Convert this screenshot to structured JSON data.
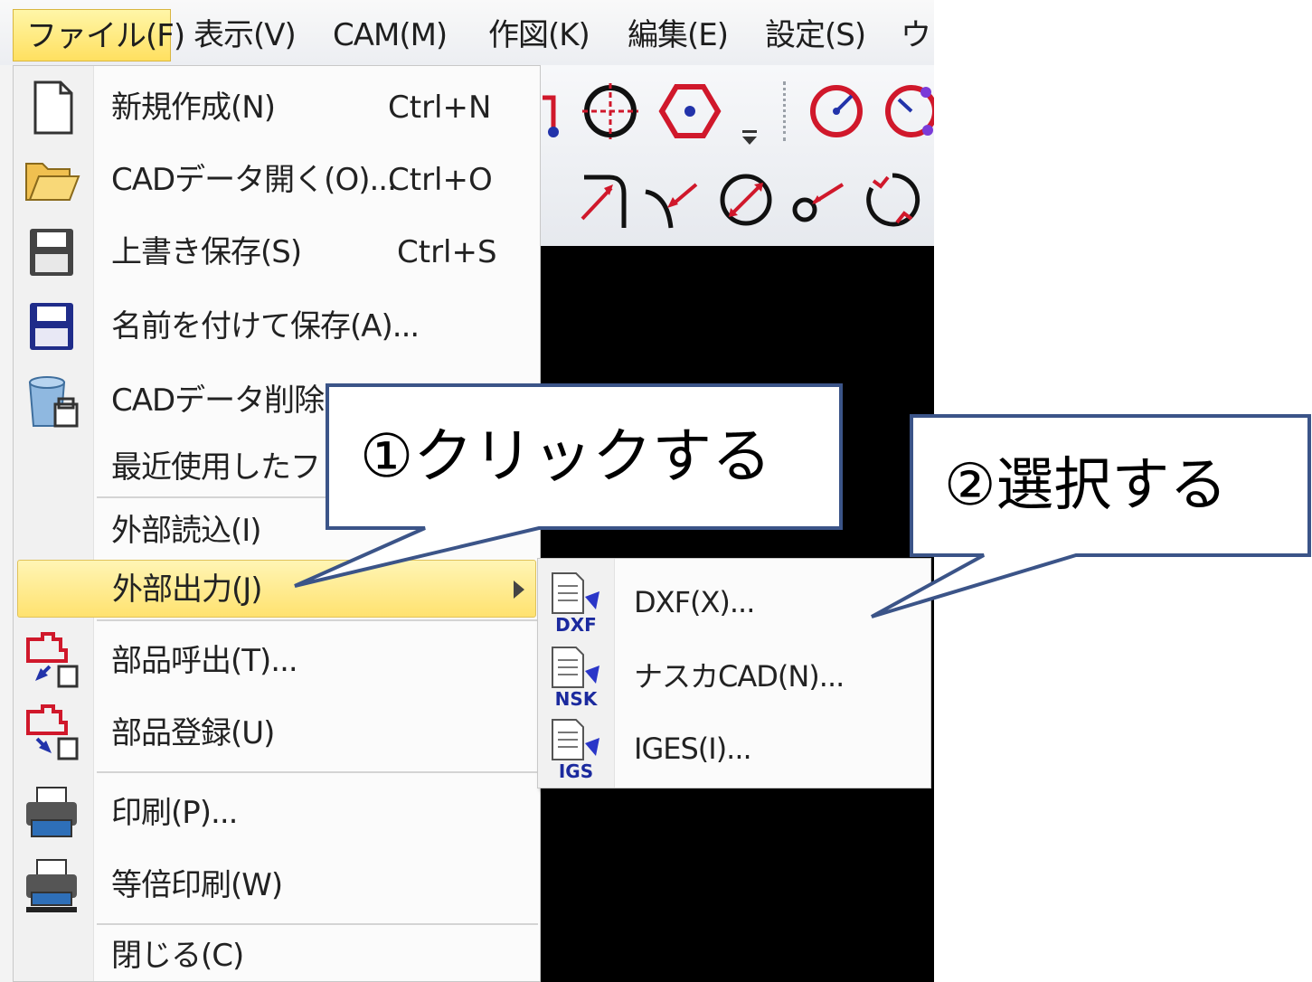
{
  "menubar": {
    "items": [
      {
        "label": "ファイル(F)",
        "active": true
      },
      {
        "label": "表示(V)"
      },
      {
        "label": "CAM(M)"
      },
      {
        "label": "作図(K)"
      },
      {
        "label": "編集(E)"
      },
      {
        "label": "設定(S)"
      },
      {
        "label": "ウィ"
      }
    ]
  },
  "file_menu": {
    "items": [
      {
        "label": "新規作成(N)",
        "shortcut": "Ctrl+N",
        "icon": "new-document-icon"
      },
      {
        "label": "CADデータ開く(O)...",
        "shortcut": "Ctrl+O",
        "icon": "open-folder-icon"
      },
      {
        "label": "上書き保存(S)",
        "shortcut": "Ctrl+S",
        "icon": "save-icon"
      },
      {
        "label": "名前を付けて保存(A)...",
        "icon": "save-as-icon"
      },
      {
        "label": "CADデータ削除(D",
        "icon": "delete-data-icon"
      },
      {
        "label": "最近使用したファイ"
      },
      {
        "label": "外部読込(I)"
      },
      {
        "label": "外部出力(J)",
        "highlighted": true,
        "has_submenu": true
      },
      {
        "label": "部品呼出(T)...",
        "icon": "part-call-icon"
      },
      {
        "label": "部品登録(U)",
        "icon": "part-register-icon"
      },
      {
        "label": "印刷(P)...",
        "icon": "print-icon"
      },
      {
        "label": "等倍印刷(W)",
        "icon": "actual-size-print-icon"
      },
      {
        "label": "閉じる(C)"
      }
    ]
  },
  "submenu": {
    "items": [
      {
        "label": "DXF(X)...",
        "icon_text": "DXF"
      },
      {
        "label": "ナスカCAD(N)...",
        "icon_text": "NSK"
      },
      {
        "label": "IGES(I)...",
        "icon_text": "IGS"
      }
    ]
  },
  "callouts": {
    "first": "①クリックする",
    "second": "②選択する"
  },
  "colors": {
    "highlight": "#ffe26f",
    "callout_border": "#3b5488",
    "icon_red": "#d0182b",
    "icon_blue": "#2233aa"
  }
}
